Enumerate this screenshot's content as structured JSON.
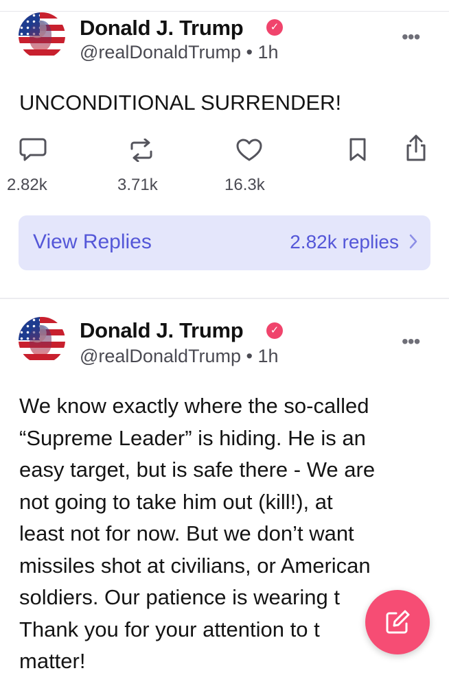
{
  "posts": [
    {
      "author": "Donald J. Trump",
      "handle": "@realDonaldTrump • 1h",
      "verified": true,
      "text": "UNCONDITIONAL SURRENDER!",
      "stats": {
        "replies": "2.82k",
        "reposts": "3.71k",
        "likes": "16.3k"
      },
      "view_replies_label": "View Replies",
      "replies_link": "2.82k replies"
    },
    {
      "author": "Donald J. Trump",
      "handle": "@realDonaldTrump • 1h",
      "verified": true,
      "text_lines": [
        "We know exactly where the so-called",
        "“Supreme Leader” is hiding. He is an",
        "easy target, but is safe there - We are",
        "not going to take him out (kill!), at",
        "least not for now. But we don’t want",
        "missiles shot at civilians, or American",
        "soldiers. Our patience is wearing t",
        "Thank you for your attention to t",
        "matter!"
      ]
    }
  ],
  "ui": {
    "more_glyph": "•••",
    "verified_glyph": "✓",
    "accent_color": "#f64d74",
    "link_color": "#5457d8",
    "icons": [
      "comment-icon",
      "repost-icon",
      "heart-icon",
      "bookmark-icon",
      "share-icon",
      "compose-icon",
      "chevron-right-icon"
    ]
  }
}
